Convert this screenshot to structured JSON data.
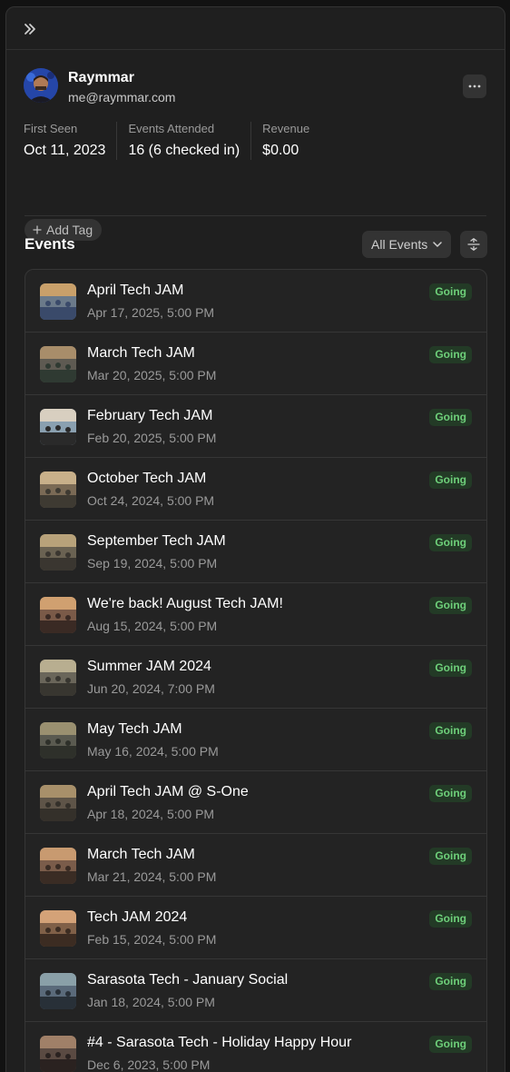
{
  "profile": {
    "name": "Raymmar",
    "email": "me@raymmar.com",
    "stats": [
      {
        "label": "First Seen",
        "value": "Oct 11, 2023"
      },
      {
        "label": "Events Attended",
        "value": "16 (6 checked in)"
      },
      {
        "label": "Revenue",
        "value": "$0.00"
      }
    ],
    "add_tag_label": "Add Tag"
  },
  "events": {
    "title": "Events",
    "filter_label": "All Events",
    "items": [
      {
        "name": "April Tech JAM",
        "date": "Apr 17, 2025, 5:00 PM",
        "status": "Going"
      },
      {
        "name": "March Tech JAM",
        "date": "Mar 20, 2025, 5:00 PM",
        "status": "Going"
      },
      {
        "name": "February Tech JAM",
        "date": "Feb 20, 2025, 5:00 PM",
        "status": "Going"
      },
      {
        "name": "October Tech JAM",
        "date": "Oct 24, 2024, 5:00 PM",
        "status": "Going"
      },
      {
        "name": "September Tech JAM",
        "date": "Sep 19, 2024, 5:00 PM",
        "status": "Going"
      },
      {
        "name": "We're back! August Tech JAM!",
        "date": "Aug 15, 2024, 5:00 PM",
        "status": "Going"
      },
      {
        "name": "Summer JAM 2024",
        "date": "Jun 20, 2024, 7:00 PM",
        "status": "Going"
      },
      {
        "name": "May Tech JAM",
        "date": "May 16, 2024, 5:00 PM",
        "status": "Going"
      },
      {
        "name": "April Tech JAM @ S-One",
        "date": "Apr 18, 2024, 5:00 PM",
        "status": "Going"
      },
      {
        "name": "March Tech JAM",
        "date": "Mar 21, 2024, 5:00 PM",
        "status": "Going"
      },
      {
        "name": "Tech JAM 2024",
        "date": "Feb 15, 2024, 5:00 PM",
        "status": "Going"
      },
      {
        "name": "Sarasota Tech - January Social",
        "date": "Jan 18, 2024, 5:00 PM",
        "status": "Going"
      },
      {
        "name": "#4 - Sarasota Tech - Holiday Happy Hour",
        "date": "Dec 6, 2023, 5:00 PM",
        "status": "Going"
      }
    ]
  },
  "colors": {
    "background": "#1f1f1f",
    "badge_bg": "#233a26",
    "badge_text": "#6ed07a"
  },
  "icons": {
    "collapse": "double-chevron-right-icon",
    "more": "ellipsis-icon",
    "add": "plus-icon",
    "dropdown": "chevron-down-icon",
    "sort": "expand-collapse-icon"
  }
}
